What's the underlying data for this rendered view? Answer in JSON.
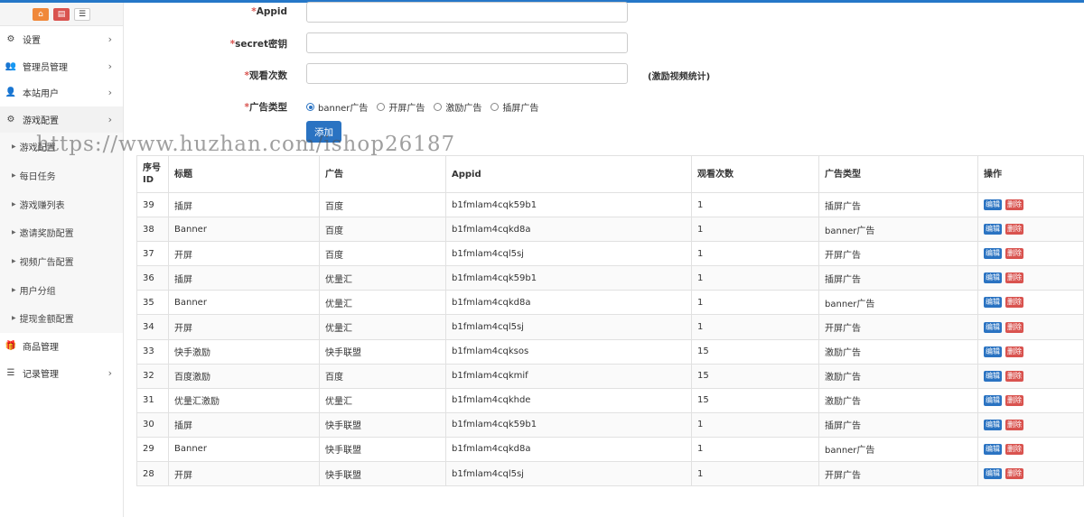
{
  "sidebar": {
    "top_buttons": [
      "home-icon",
      "trash-icon",
      "list-icon"
    ],
    "menu": [
      {
        "label": "设置",
        "icon": "gear-icon",
        "glyph": "⚙",
        "has_arrow": true
      },
      {
        "label": "管理员管理",
        "icon": "users-icon",
        "glyph": "👥",
        "has_arrow": true
      },
      {
        "label": "本站用户",
        "icon": "user-icon",
        "glyph": "👤",
        "has_arrow": true
      },
      {
        "label": "游戏配置",
        "icon": "gear-icon",
        "glyph": "⚙",
        "has_arrow": true
      }
    ],
    "submenu": [
      "游戏配置",
      "每日任务",
      "游戏赚列表",
      "邀请奖励配置",
      "视频广告配置",
      "用户分组",
      "提现金额配置"
    ],
    "bottom_menu": [
      {
        "label": "商品管理",
        "icon": "gift-icon",
        "glyph": "🎁",
        "has_arrow": false
      },
      {
        "label": "记录管理",
        "icon": "list-icon",
        "glyph": "☰",
        "has_arrow": true
      }
    ]
  },
  "form": {
    "appid_label": "Appid",
    "secret_label": "secret密钥",
    "views_label": "观看次数",
    "views_hint": "(激励视频统计)",
    "type_label": "广告类型",
    "required_mark": "*",
    "ad_types": [
      {
        "label": "banner广告",
        "checked": true
      },
      {
        "label": "开屏广告",
        "checked": false
      },
      {
        "label": "激励广告",
        "checked": false
      },
      {
        "label": "插屏广告",
        "checked": false
      }
    ],
    "submit_label": "添加"
  },
  "watermark": "https://www.huzhan.com/ishop26187",
  "table": {
    "headers": {
      "id": "序号\nID",
      "title": "标题",
      "ad": "广告",
      "appid": "Appid",
      "views": "观看次数",
      "type": "广告类型",
      "ops": "操作"
    },
    "edit_label": "编辑",
    "delete_label": "删除",
    "rows": [
      {
        "id": "39",
        "title": "插屏",
        "ad": "百度",
        "appid": "b1fmlam4cqk59b1",
        "views": "1",
        "type": "插屏广告"
      },
      {
        "id": "38",
        "title": "Banner",
        "ad": "百度",
        "appid": "b1fmlam4cqkd8a",
        "views": "1",
        "type": "banner广告"
      },
      {
        "id": "37",
        "title": "开屏",
        "ad": "百度",
        "appid": "b1fmlam4cql5sj",
        "views": "1",
        "type": "开屏广告"
      },
      {
        "id": "36",
        "title": "插屏",
        "ad": "优量汇",
        "appid": "b1fmlam4cqk59b1",
        "views": "1",
        "type": "插屏广告"
      },
      {
        "id": "35",
        "title": "Banner",
        "ad": "优量汇",
        "appid": "b1fmlam4cqkd8a",
        "views": "1",
        "type": "banner广告"
      },
      {
        "id": "34",
        "title": "开屏",
        "ad": "优量汇",
        "appid": "b1fmlam4cql5sj",
        "views": "1",
        "type": "开屏广告"
      },
      {
        "id": "33",
        "title": "快手激励",
        "ad": "快手联盟",
        "appid": "b1fmlam4cqksos",
        "views": "15",
        "type": "激励广告"
      },
      {
        "id": "32",
        "title": "百度激励",
        "ad": "百度",
        "appid": "b1fmlam4cqkmif",
        "views": "15",
        "type": "激励广告"
      },
      {
        "id": "31",
        "title": "优量汇激励",
        "ad": "优量汇",
        "appid": "b1fmlam4cqkhde",
        "views": "15",
        "type": "激励广告"
      },
      {
        "id": "30",
        "title": "插屏",
        "ad": "快手联盟",
        "appid": "b1fmlam4cqk59b1",
        "views": "1",
        "type": "插屏广告"
      },
      {
        "id": "29",
        "title": "Banner",
        "ad": "快手联盟",
        "appid": "b1fmlam4cqkd8a",
        "views": "1",
        "type": "banner广告"
      },
      {
        "id": "28",
        "title": "开屏",
        "ad": "快手联盟",
        "appid": "b1fmlam4cql5sj",
        "views": "1",
        "type": "开屏广告"
      }
    ]
  }
}
